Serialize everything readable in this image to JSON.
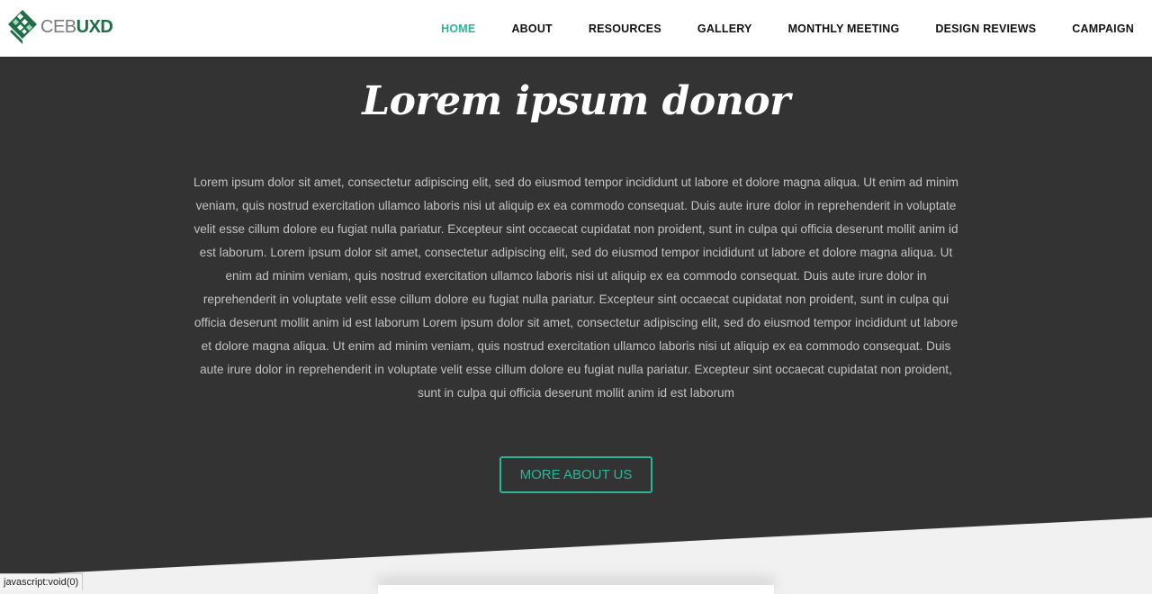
{
  "brand": {
    "prefix": "CEB",
    "suffix": "UXD",
    "logo_icon": "diamond-grid-logo"
  },
  "nav": {
    "items": [
      {
        "label": "HOME",
        "active": true
      },
      {
        "label": "ABOUT",
        "active": false
      },
      {
        "label": "RESOURCES",
        "active": false
      },
      {
        "label": "GALLERY",
        "active": false
      },
      {
        "label": "MONTHLY MEETING",
        "active": false
      },
      {
        "label": "DESIGN REVIEWS",
        "active": false
      },
      {
        "label": "CAMPAIGN",
        "active": false
      }
    ]
  },
  "hero": {
    "title": "Lorem ipsum donor",
    "body": "Lorem ipsum dolor sit amet, consectetur adipiscing elit, sed do eiusmod tempor incididunt ut labore et dolore magna aliqua. Ut enim ad minim veniam, quis nostrud exercitation ullamco laboris nisi ut aliquip ex ea commodo consequat. Duis aute irure dolor in reprehenderit in voluptate velit esse cillum dolore eu fugiat nulla pariatur. Excepteur sint occaecat cupidatat non proident, sunt in culpa qui officia deserunt mollit anim id est laborum. Lorem ipsum dolor sit amet, consectetur adipiscing elit, sed do eiusmod tempor incididunt ut labore et dolore magna aliqua. Ut enim ad minim veniam, quis nostrud exercitation ullamco laboris nisi ut aliquip ex ea commodo consequat. Duis aute irure dolor in reprehenderit in voluptate velit esse cillum dolore eu fugiat nulla pariatur. Excepteur sint occaecat cupidatat non proident, sunt in culpa qui officia deserunt mollit anim id est laborum Lorem ipsum dolor sit amet, consectetur adipiscing elit, sed do eiusmod tempor incididunt ut labore et dolore magna aliqua. Ut enim ad minim veniam, quis nostrud exercitation ullamco laboris nisi ut aliquip ex ea commodo consequat. Duis aute irure dolor in reprehenderit in voluptate velit esse cillum dolore eu fugiat nulla pariatur. Excepteur sint occaecat cupidatat non proident, sunt in culpa qui officia deserunt mollit anim id est laborum",
    "cta_label": "MORE ABOUT US"
  },
  "status_bar": {
    "text": "javascript:void(0)"
  },
  "colors": {
    "accent": "#2ab59a",
    "hero_bg": "#333333",
    "section_bg": "#f1f1f1",
    "logo_green": "#1f6e45"
  }
}
